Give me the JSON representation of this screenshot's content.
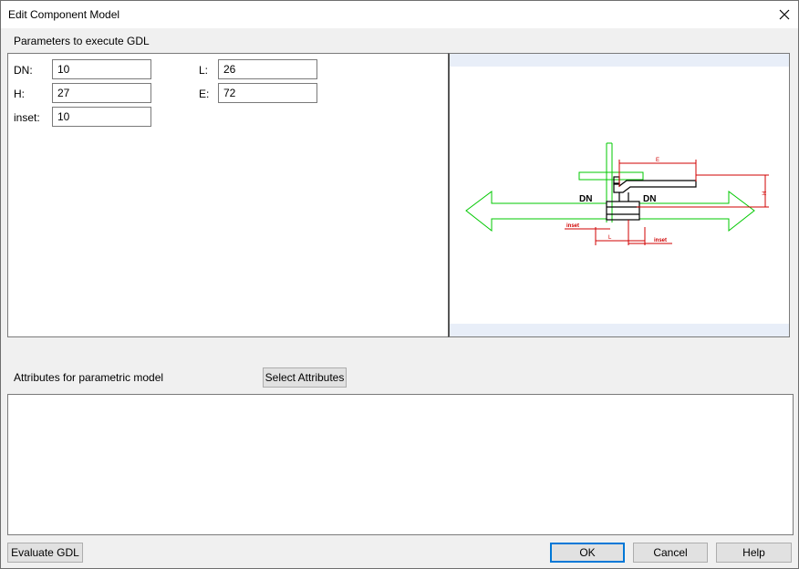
{
  "window": {
    "title": "Edit Component Model"
  },
  "params": {
    "heading": "Parameters to execute GDL",
    "fields": {
      "dn": {
        "label": "DN:",
        "value": "10"
      },
      "h": {
        "label": "H:",
        "value": "27"
      },
      "inset": {
        "label": "inset:",
        "value": "10"
      },
      "l": {
        "label": "L:",
        "value": "26"
      },
      "e": {
        "label": "E:",
        "value": "72"
      }
    }
  },
  "preview": {
    "labels": {
      "dn_left": "DN",
      "dn_right": "DN",
      "e": "E",
      "h": "H",
      "l": "L",
      "inset_left": "inset",
      "inset_right": "inset"
    },
    "colors": {
      "model": "#00c800",
      "dimension": "#d00000",
      "outline": "#000000"
    }
  },
  "attributes": {
    "heading": "Attributes for parametric model",
    "select_button": "Select Attributes"
  },
  "footer": {
    "evaluate_button": "Evaluate GDL",
    "ok_button": "OK",
    "cancel_button": "Cancel",
    "help_button": "Help"
  }
}
